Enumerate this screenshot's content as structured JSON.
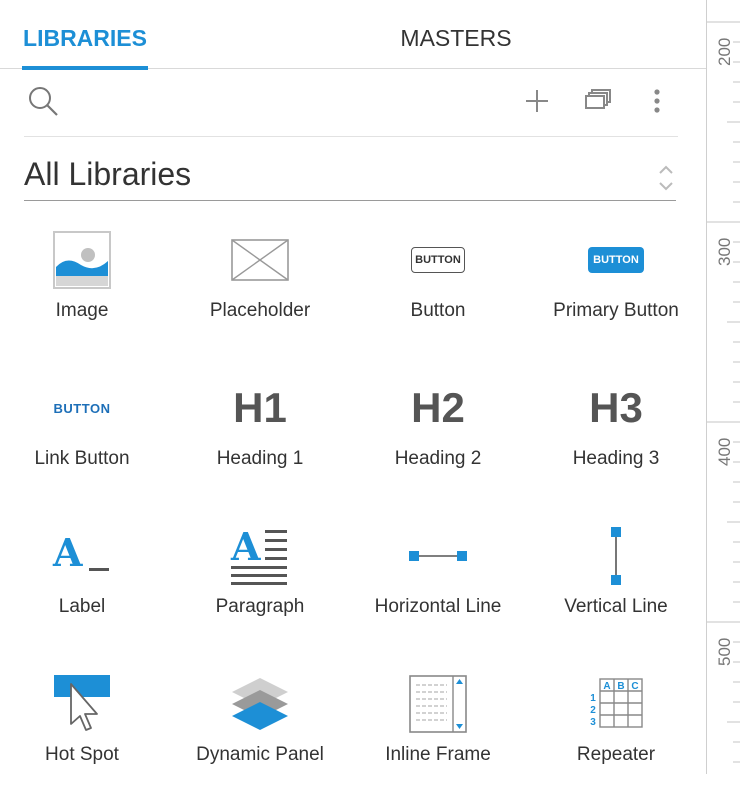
{
  "tabs": [
    {
      "label": "LIBRARIES",
      "active": true
    },
    {
      "label": "MASTERS",
      "active": false
    }
  ],
  "toolbar": {
    "icons": [
      "search-icon",
      "plus-icon",
      "windows-stack-icon",
      "more-vertical-icon"
    ]
  },
  "library_select": {
    "value": "All Libraries"
  },
  "widgets": [
    {
      "label": "Image",
      "icon": "image-icon"
    },
    {
      "label": "Placeholder",
      "icon": "placeholder-icon"
    },
    {
      "label": "Button",
      "icon": "button-icon",
      "icon_text": "BUTTON"
    },
    {
      "label": "Primary Button",
      "icon": "primary-button-icon",
      "icon_text": "BUTTON"
    },
    {
      "label": "Link Button",
      "icon": "link-button-icon",
      "icon_text": "BUTTON"
    },
    {
      "label": "Heading 1",
      "icon": "heading-1-icon",
      "icon_text": "H1"
    },
    {
      "label": "Heading 2",
      "icon": "heading-2-icon",
      "icon_text": "H2"
    },
    {
      "label": "Heading 3",
      "icon": "heading-3-icon",
      "icon_text": "H3"
    },
    {
      "label": "Label",
      "icon": "label-icon",
      "icon_text": "A"
    },
    {
      "label": "Paragraph",
      "icon": "paragraph-icon",
      "icon_text": "A"
    },
    {
      "label": "Horizontal Line",
      "icon": "horizontal-line-icon"
    },
    {
      "label": "Vertical Line",
      "icon": "vertical-line-icon"
    },
    {
      "label": "Hot Spot",
      "icon": "hot-spot-icon"
    },
    {
      "label": "Dynamic Panel",
      "icon": "dynamic-panel-icon"
    },
    {
      "label": "Inline Frame",
      "icon": "inline-frame-icon"
    },
    {
      "label": "Repeater",
      "icon": "repeater-icon",
      "icon_text": [
        "A",
        "B",
        "C",
        "1",
        "2",
        "3"
      ]
    }
  ],
  "ruler": {
    "labels": [
      "200",
      "300",
      "400",
      "500"
    ]
  },
  "colors": {
    "accent": "#1d8fd6",
    "text": "#333333",
    "icon_gray": "#888888"
  }
}
